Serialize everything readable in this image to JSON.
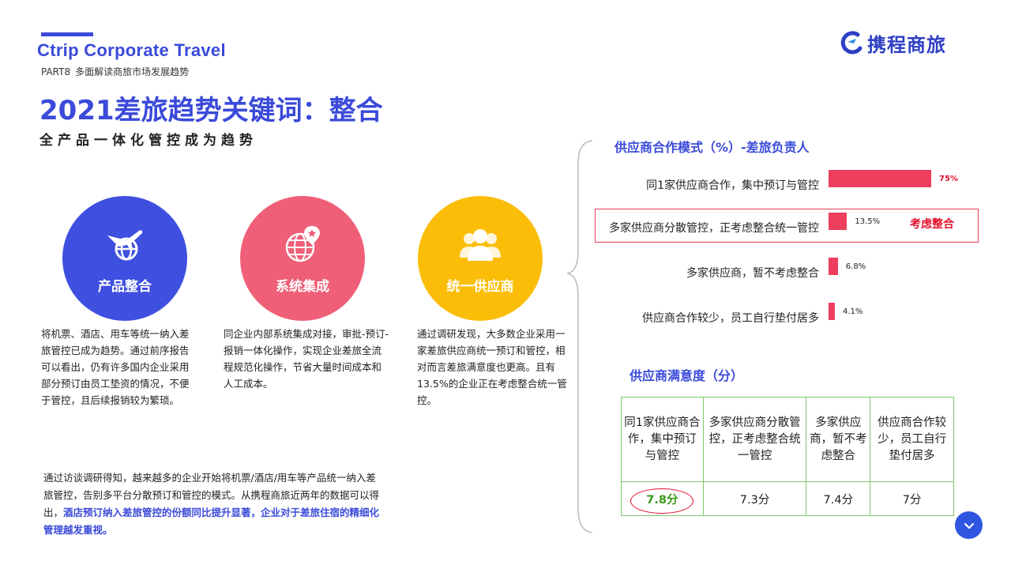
{
  "header": {
    "brand": "Ctrip Corporate Travel",
    "part_label": "PART8",
    "part_title": "多面解读商旅市场发展趋势",
    "logo_text": "携程商旅"
  },
  "main": {
    "title": "2021差旅趋势关键词：整合",
    "subtitle": "全产品一体化管控成为趋势"
  },
  "features": [
    {
      "label": "产品整合",
      "icon": "plane-globe-icon",
      "color": "#3f4fe0",
      "desc": "将机票、酒店、用车等统一纳入差旅管控已成为趋势。通过前序报告可以看出，仍有许多国内企业采用部分预订由员工垫资的情况，不便于管控，且后续报销较为繁琐。"
    },
    {
      "label": "系统集成",
      "icon": "globe-pin-icon",
      "color": "#ef5f78",
      "desc": "同企业内部系统集成对接，审批-预订-报销一体化操作，实现企业差旅全流程规范化操作，节省大量时间成本和人工成本。"
    },
    {
      "label": "统一供应商",
      "icon": "people-group-icon",
      "color": "#fbbd08",
      "desc": "通过调研发现，大多数企业采用一家差旅供应商统一预订和管控，相对而言差旅满意度也更高。且有13.5%的企业正在考虑整合统一管控。"
    }
  ],
  "bottom_note": {
    "text": "通过访谈调研得知，越来越多的企业开始将机票/酒店/用车等产品统一纳入差旅管控，告别多平台分散预订和管控的模式。从携程商旅近两年的数据可以得出，",
    "highlight": "酒店预订纳入差旅管控的份额同比提升显著，企业对于差旅住宿的精细化管理越发重视。"
  },
  "supplier_mode": {
    "title": "供应商合作模式（%）-差旅负责人",
    "callout": "考虑整合",
    "bar_color": "#ed3e5e"
  },
  "chart_data": {
    "type": "bar",
    "title": "供应商合作模式（%）-差旅负责人",
    "categories": [
      "同1家供应商合作，集中预订与管控",
      "多家供应商分散管控，正考虑整合统一管控",
      "多家供应商，暂不考虑整合",
      "供应商合作较少，员工自行垫付居多"
    ],
    "values": [
      75,
      13.5,
      6.8,
      4.1
    ],
    "value_labels": [
      "75%",
      "13.5%",
      "6.8%",
      "4.1%"
    ],
    "xlim": [
      0,
      100
    ]
  },
  "satisfaction": {
    "title": "供应商满意度（分）",
    "headers": [
      "同1家供应商合作，集中预订与管控",
      "多家供应商分散管控，正考虑整合统一管控",
      "多家供应商，暂不考虑整合",
      "供应商合作较少，员工自行垫付居多"
    ],
    "values": [
      "7.8分",
      "7.3分",
      "7.4分",
      "7分"
    ]
  },
  "fab": {
    "icon": "chevron-down-icon"
  }
}
